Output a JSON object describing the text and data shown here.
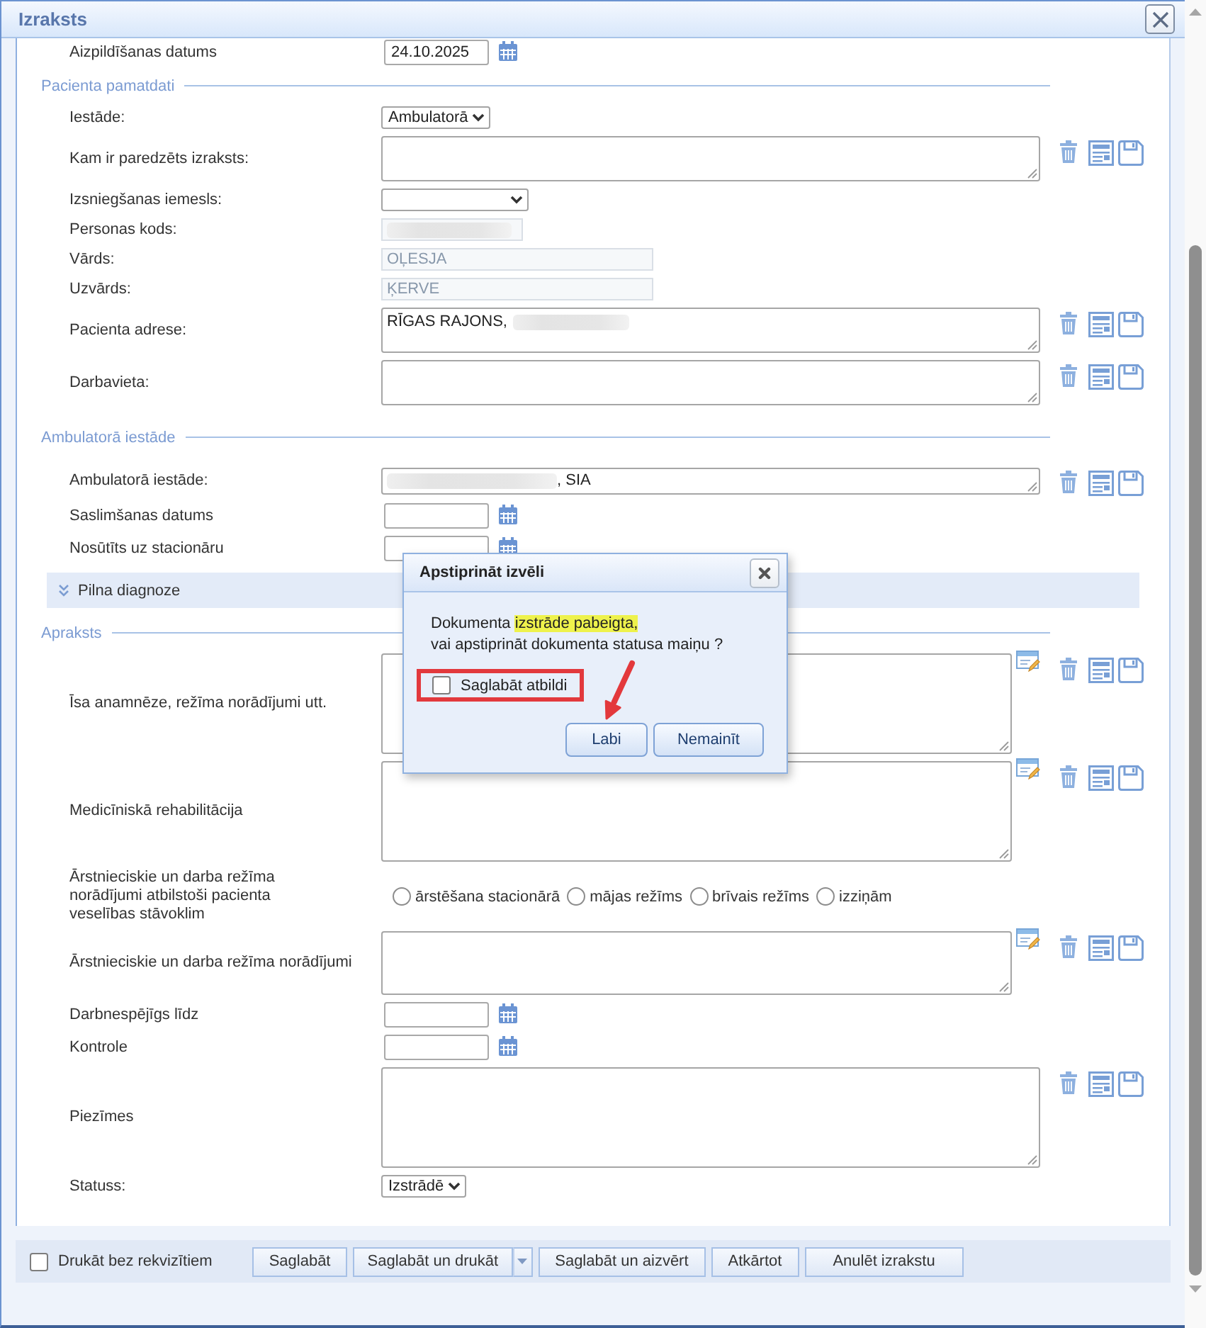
{
  "window": {
    "title": "Izraksts"
  },
  "form": [
    {
      "kind": "date",
      "label": "Aizpildīšanas datums",
      "value": "24.10.2025",
      "disabled": false
    },
    {
      "kind": "section",
      "title": "Pacienta pamatdati"
    },
    {
      "kind": "select",
      "label": "Iestāde:",
      "value": "Ambulatorā",
      "disabled": false
    },
    {
      "kind": "textarea",
      "label": "Kam ir paredzēts izraksts:",
      "disabled": false,
      "editor": false
    },
    {
      "kind": "select",
      "label": "Izsniegšanas iemesls:",
      "disabled": false
    },
    {
      "kind": "text",
      "label": "Personas kods:",
      "disabled": true,
      "value_parts": [
        {
          "kind": "blur"
        }
      ]
    },
    {
      "kind": "text",
      "label": "Vārds:",
      "value": "OĻESJA",
      "disabled": true
    },
    {
      "kind": "text",
      "label": "Uzvārds:",
      "value": "ĶERVE",
      "disabled": true
    },
    {
      "kind": "textarea",
      "label": "Pacienta adrese:",
      "value_parts": [
        {
          "kind": "text",
          "text": "RĪGAS RAJONS,"
        },
        {
          "kind": "blur"
        }
      ],
      "disabled": false,
      "editor": false
    },
    {
      "kind": "textarea",
      "label": "Darbavieta:",
      "disabled": false,
      "editor": false
    },
    {
      "kind": "section",
      "title": "Ambulatorā iestāde"
    },
    {
      "kind": "textarea",
      "label": "Ambulatorā iestāde:",
      "value_parts": [
        {
          "kind": "blur"
        },
        {
          "kind": "text",
          "text": ", SIA"
        }
      ],
      "disabled": false,
      "editor": false
    },
    {
      "kind": "date",
      "label": "Saslimšanas datums",
      "disabled": false
    },
    {
      "kind": "date",
      "label": "Nosūtīts uz stacionāru",
      "disabled": false
    },
    {
      "kind": "collapsible",
      "title": "Pilna diagnoze",
      "expanded": false
    },
    {
      "kind": "section",
      "title": "Apraksts"
    },
    {
      "kind": "textarea",
      "label": "Īsa anamnēze, režīma norādījumi utt.",
      "disabled": false,
      "editor": true
    },
    {
      "kind": "textarea",
      "label": "Medicīniskā rehabilitācija",
      "disabled": false,
      "editor": true
    },
    {
      "kind": "radio",
      "label": "Ārstnieciskie un darba režīma norādījumi atbilstoši pacienta veselības stāvoklim",
      "options": [
        {
          "label": "ārstēšana stacionārā",
          "selected": false
        },
        {
          "label": "mājas režīms",
          "selected": false
        },
        {
          "label": "brīvais režīms",
          "selected": false
        },
        {
          "label": "izziņām",
          "selected": false
        }
      ]
    },
    {
      "kind": "textarea",
      "label": "Ārstnieciskie un darba režīma norādījumi",
      "disabled": false,
      "editor": true
    },
    {
      "kind": "date",
      "label": "Darbnespējīgs līdz",
      "disabled": false
    },
    {
      "kind": "date",
      "label": "Kontrole",
      "disabled": false
    },
    {
      "kind": "textarea",
      "label": "Piezīmes",
      "disabled": false,
      "editor": false
    },
    {
      "kind": "select",
      "label": "Statuss:",
      "value": "Izstrādē",
      "disabled": false
    }
  ],
  "footer": {
    "checkbox": {
      "label": "Drukāt bez rekvizītiem",
      "checked": false
    },
    "buttons": [
      {
        "label": "Saglabāt",
        "menu": false
      },
      {
        "label": "Saglabāt un drukāt",
        "menu": true
      },
      {
        "label": "Saglabāt un aizvērt",
        "menu": false
      },
      {
        "label": "Atkārtot",
        "menu": false
      },
      {
        "label": "Anulēt izrakstu",
        "menu": false
      }
    ]
  },
  "dialog": {
    "title": "Apstiprināt izvēli",
    "message_lines": [
      [
        {
          "text": "Dokumenta ",
          "highlighted": false
        },
        {
          "text": "izstrāde pabeigta,",
          "highlighted": true
        }
      ],
      [
        {
          "text": "vai apstiprināt dokumenta statusa maiņu ?",
          "highlighted": false
        }
      ]
    ],
    "checkbox": {
      "label": "Saglabāt atbildi",
      "checked": false,
      "framed": true
    },
    "buttons": [
      {
        "label": "Labi"
      },
      {
        "label": "Nemainīt"
      }
    ],
    "annotation_arrow": true
  }
}
